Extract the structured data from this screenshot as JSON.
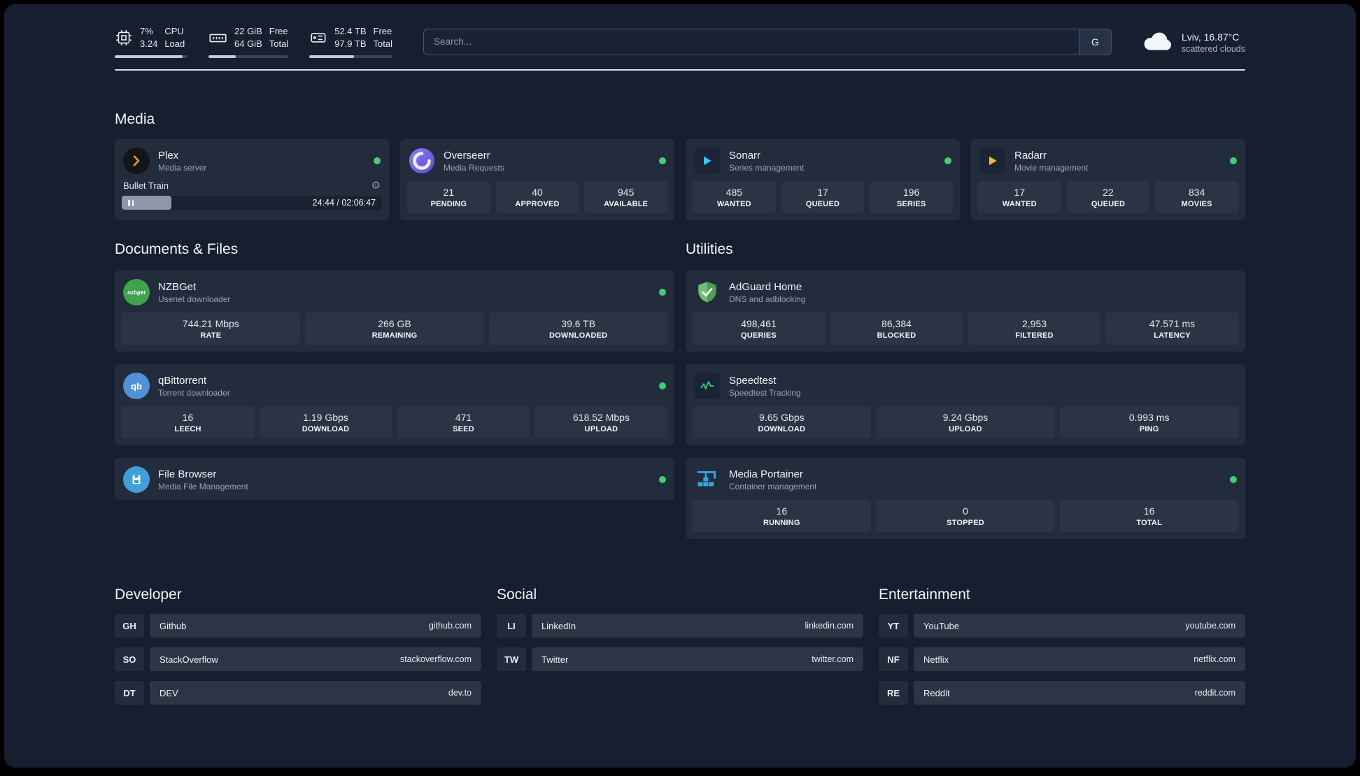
{
  "topbar": {
    "cpu": {
      "usage": "7%",
      "load": "3.24",
      "label_top": "CPU",
      "label_bottom": "Load",
      "progress": 93
    },
    "memory": {
      "free": "22 GiB",
      "total": "64 GiB",
      "label_top": "Free",
      "label_bottom": "Total",
      "progress": 34
    },
    "disk": {
      "free": "52.4 TB",
      "total": "97.9 TB",
      "label_top": "Free",
      "label_bottom": "Total",
      "progress": 54
    },
    "search": {
      "placeholder": "Search...",
      "provider_button": "G"
    },
    "weather": {
      "location": "Lviv, 16.87°C",
      "condition": "scattered clouds"
    }
  },
  "sections": {
    "media": "Media",
    "documents": "Documents & Files",
    "utilities": "Utilities",
    "developer": "Developer",
    "social": "Social",
    "entertainment": "Entertainment"
  },
  "apps": {
    "plex": {
      "title": "Plex",
      "subtitle": "Media server",
      "now_playing": "Bullet Train",
      "time": "24:44 / 02:06:47",
      "progress": 19
    },
    "overseerr": {
      "title": "Overseerr",
      "subtitle": "Media Requests",
      "stats": [
        {
          "value": "21",
          "label": "PENDING"
        },
        {
          "value": "40",
          "label": "APPROVED"
        },
        {
          "value": "945",
          "label": "AVAILABLE"
        }
      ]
    },
    "sonarr": {
      "title": "Sonarr",
      "subtitle": "Series management",
      "stats": [
        {
          "value": "485",
          "label": "WANTED"
        },
        {
          "value": "17",
          "label": "QUEUED"
        },
        {
          "value": "196",
          "label": "SERIES"
        }
      ]
    },
    "radarr": {
      "title": "Radarr",
      "subtitle": "Movie management",
      "stats": [
        {
          "value": "17",
          "label": "WANTED"
        },
        {
          "value": "22",
          "label": "QUEUED"
        },
        {
          "value": "834",
          "label": "MOVIES"
        }
      ]
    },
    "nzbget": {
      "title": "NZBGet",
      "subtitle": "Usenet downloader",
      "icon_text": "nzbget",
      "stats": [
        {
          "value": "744.21 Mbps",
          "label": "RATE"
        },
        {
          "value": "266 GB",
          "label": "REMAINING"
        },
        {
          "value": "39.6 TB",
          "label": "DOWNLOADED"
        }
      ]
    },
    "qbittorrent": {
      "title": "qBittorrent",
      "subtitle": "Torrent downloader",
      "icon_text": "qb",
      "stats": [
        {
          "value": "16",
          "label": "LEECH"
        },
        {
          "value": "1.19 Gbps",
          "label": "DOWNLOAD"
        },
        {
          "value": "471",
          "label": "SEED"
        },
        {
          "value": "618.52 Mbps",
          "label": "UPLOAD"
        }
      ]
    },
    "filebrowser": {
      "title": "File Browser",
      "subtitle": "Media File Management"
    },
    "adguard": {
      "title": "AdGuard Home",
      "subtitle": "DNS and adblocking",
      "stats": [
        {
          "value": "498,461",
          "label": "QUERIES"
        },
        {
          "value": "86,384",
          "label": "BLOCKED"
        },
        {
          "value": "2,953",
          "label": "FILTERED"
        },
        {
          "value": "47.571 ms",
          "label": "LATENCY"
        }
      ]
    },
    "speedtest": {
      "title": "Speedtest",
      "subtitle": "Speedtest Tracking",
      "stats": [
        {
          "value": "9.65 Gbps",
          "label": "DOWNLOAD"
        },
        {
          "value": "9.24 Gbps",
          "label": "UPLOAD"
        },
        {
          "value": "0.993 ms",
          "label": "PING"
        }
      ]
    },
    "portainer": {
      "title": "Media Portainer",
      "subtitle": "Container management",
      "stats": [
        {
          "value": "16",
          "label": "RUNNING"
        },
        {
          "value": "0",
          "label": "STOPPED"
        },
        {
          "value": "16",
          "label": "TOTAL"
        }
      ]
    }
  },
  "links": {
    "developer": [
      {
        "abbr": "GH",
        "name": "Github",
        "domain": "github.com"
      },
      {
        "abbr": "SO",
        "name": "StackOverflow",
        "domain": "stackoverflow.com"
      },
      {
        "abbr": "DT",
        "name": "DEV",
        "domain": "dev.to"
      }
    ],
    "social": [
      {
        "abbr": "LI",
        "name": "LinkedIn",
        "domain": "linkedin.com"
      },
      {
        "abbr": "TW",
        "name": "Twitter",
        "domain": "twitter.com"
      }
    ],
    "entertainment": [
      {
        "abbr": "YT",
        "name": "YouTube",
        "domain": "youtube.com"
      },
      {
        "abbr": "NF",
        "name": "Netflix",
        "domain": "netflix.com"
      },
      {
        "abbr": "RE",
        "name": "Reddit",
        "domain": "reddit.com"
      }
    ]
  },
  "colors": {
    "background": "#161e2f",
    "card": "#232c3c",
    "tile": "#2b3445",
    "status_online": "#3ecf78",
    "plex_accent": "#e5a00d",
    "sonarr_accent": "#38c6f4",
    "radarr_accent": "#f9b52f",
    "adguard_accent": "#5cb862",
    "portainer_accent": "#2fa8e0"
  }
}
